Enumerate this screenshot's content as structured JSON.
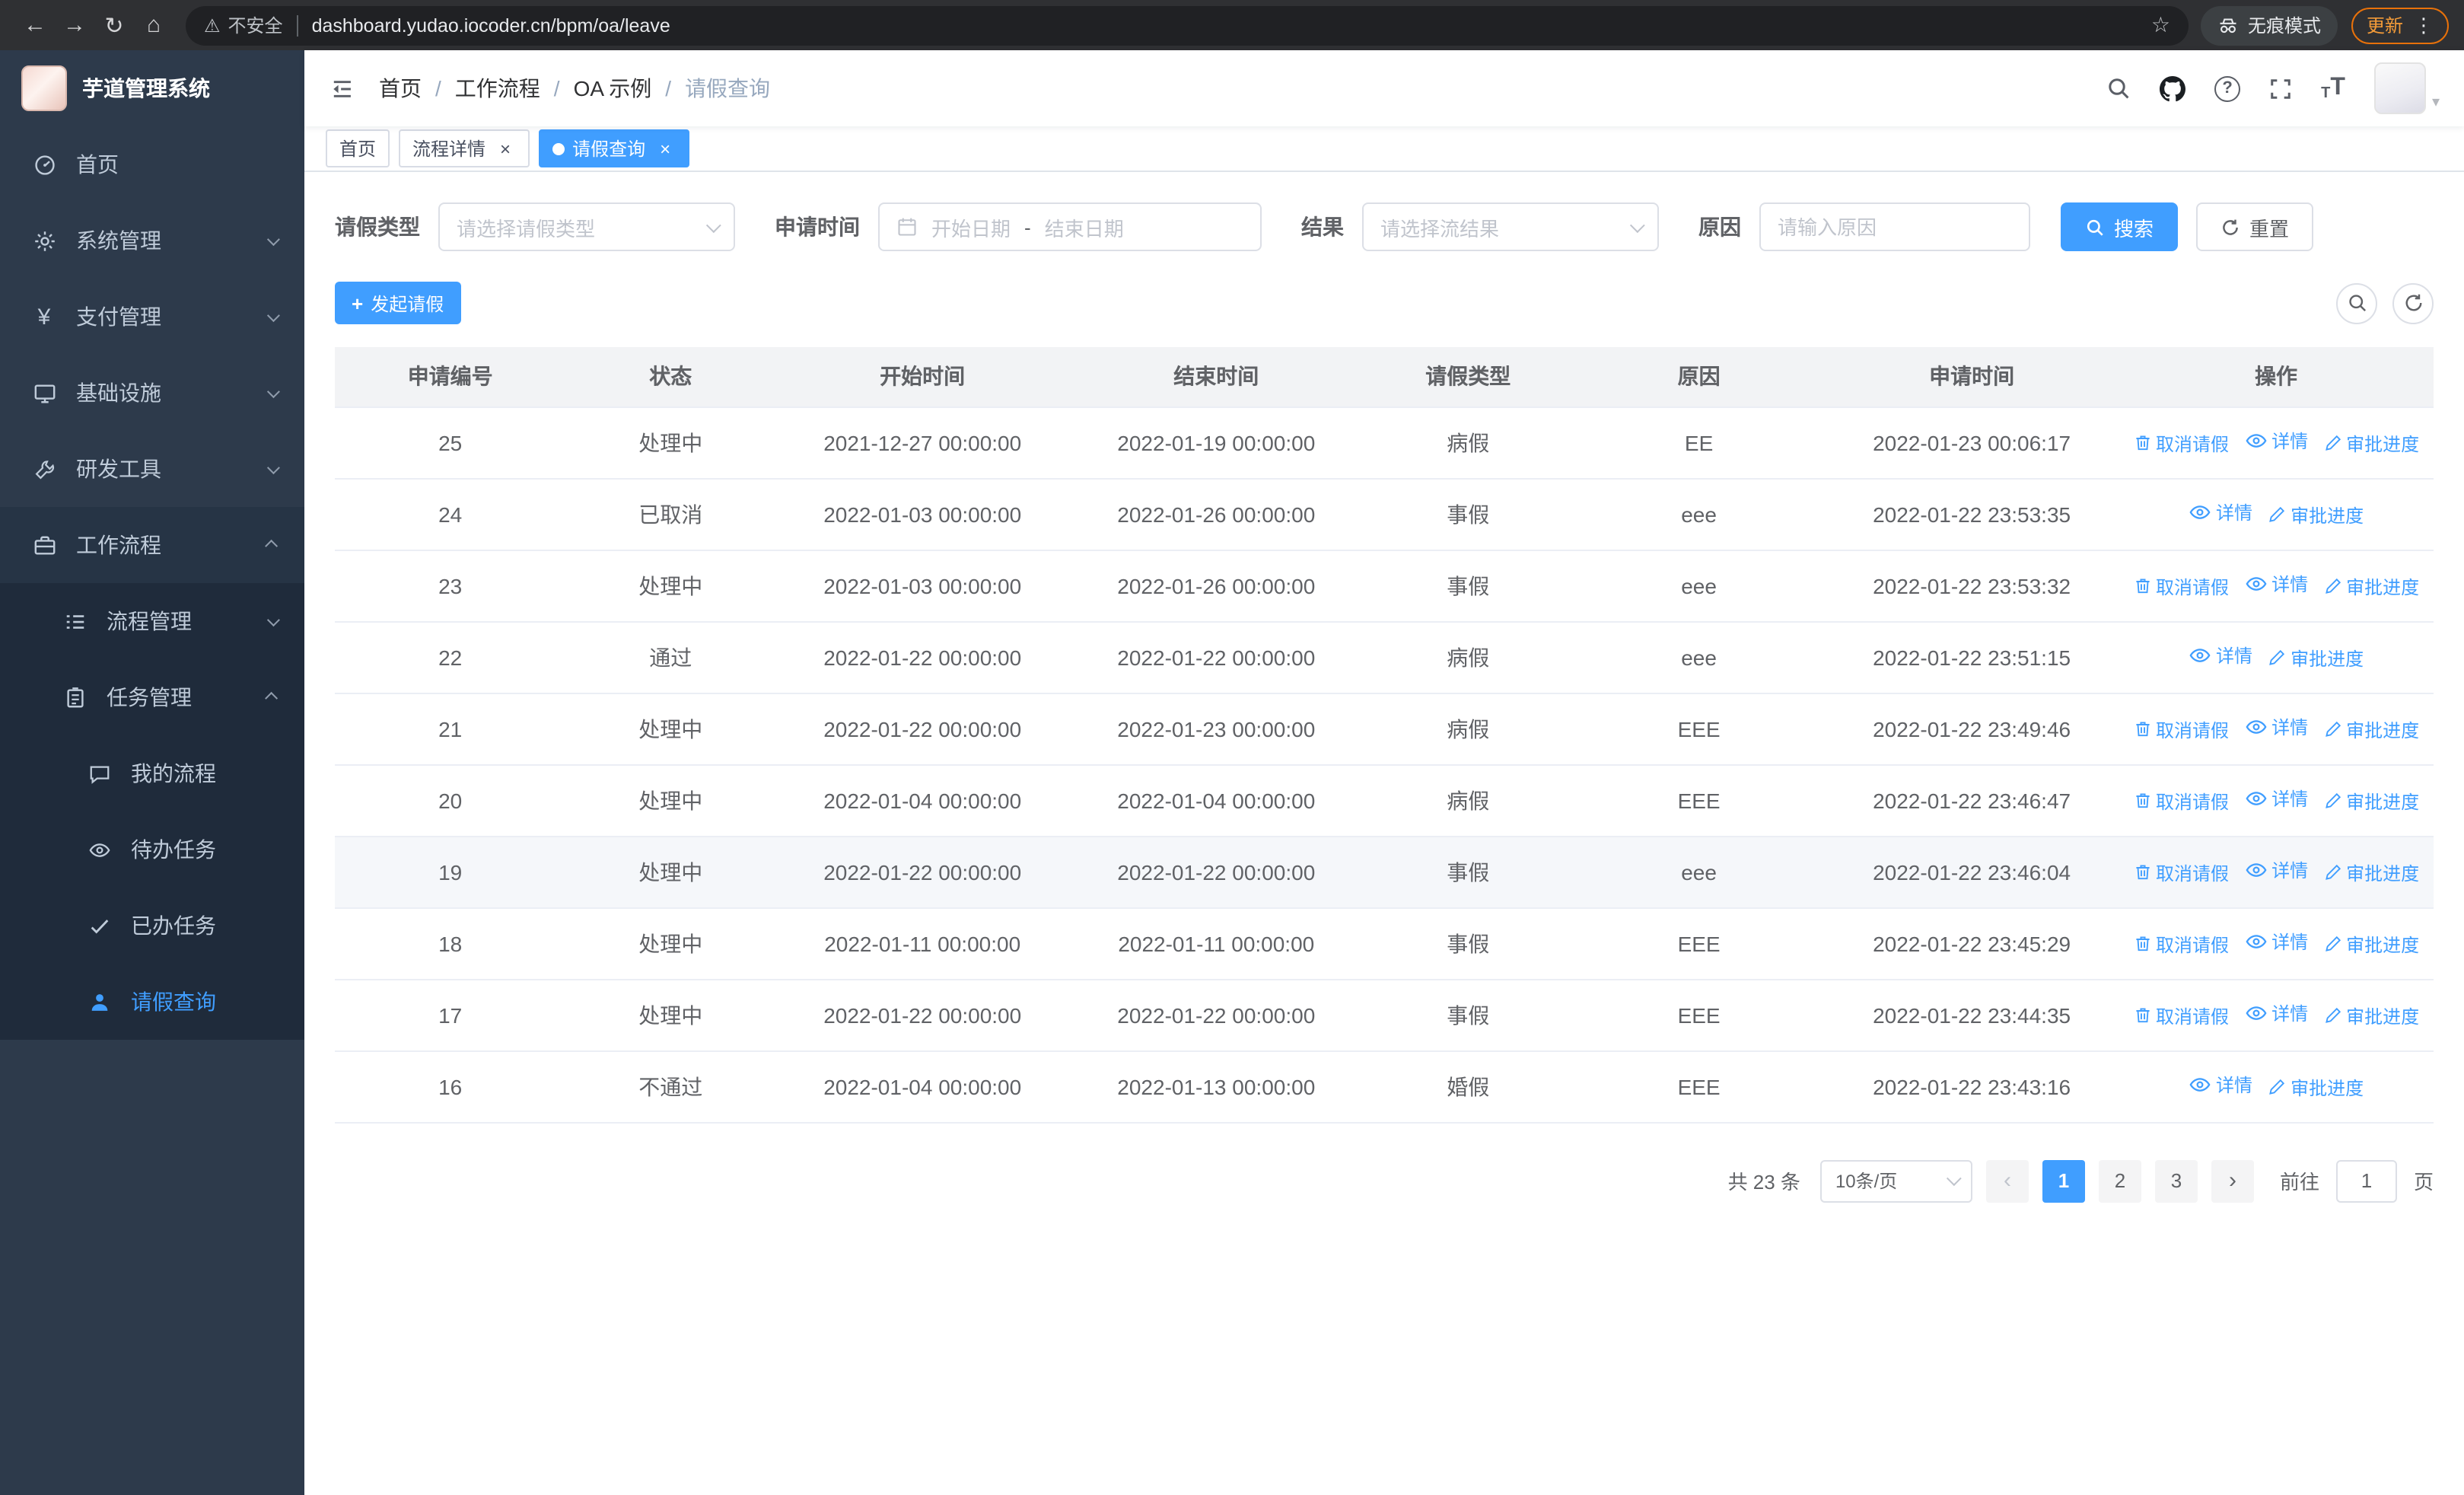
{
  "browser": {
    "security_warning": "不安全",
    "url": "dashboard.yudao.iocoder.cn/bpm/oa/leave",
    "incognito_label": "无痕模式",
    "update_label": "更新"
  },
  "sidebar": {
    "app_title": "芋道管理系统",
    "items": [
      {
        "key": "home",
        "label": "首页",
        "icon": "dashboard-icon",
        "level": 1
      },
      {
        "key": "system",
        "label": "系统管理",
        "icon": "gear-icon",
        "level": 1,
        "chevron": "down"
      },
      {
        "key": "payment",
        "label": "支付管理",
        "icon": "yen-icon",
        "level": 1,
        "chevron": "down"
      },
      {
        "key": "infrastructure",
        "label": "基础设施",
        "icon": "monitor-icon",
        "level": 1,
        "chevron": "down"
      },
      {
        "key": "devtools",
        "label": "研发工具",
        "icon": "wrench-icon",
        "level": 1,
        "chevron": "down"
      },
      {
        "key": "workflow",
        "label": "工作流程",
        "icon": "briefcase-icon",
        "level": 1,
        "chevron": "up",
        "open": true
      },
      {
        "key": "process-mgmt",
        "label": "流程管理",
        "icon": "list-icon",
        "level": 2,
        "chevron": "down",
        "submenu": true
      },
      {
        "key": "task-mgmt",
        "label": "任务管理",
        "icon": "clipboard-icon",
        "level": 2,
        "chevron": "up",
        "open": true,
        "submenu": true
      },
      {
        "key": "my-process",
        "label": "我的流程",
        "icon": "chat-icon",
        "level": 3,
        "submenu": true
      },
      {
        "key": "todo-task",
        "label": "待办任务",
        "icon": "eye-icon",
        "level": 3,
        "submenu": true
      },
      {
        "key": "done-task",
        "label": "已办任务",
        "icon": "check-icon",
        "level": 3,
        "submenu": true
      },
      {
        "key": "leave-query",
        "label": "请假查询",
        "icon": "user-icon",
        "level": 3,
        "submenu": true,
        "active": true
      }
    ]
  },
  "header": {
    "breadcrumbs": [
      "首页",
      "工作流程",
      "OA 示例",
      "请假查询"
    ]
  },
  "tabs": [
    {
      "key": "home",
      "label": "首页",
      "closable": false,
      "active": false
    },
    {
      "key": "process-detail",
      "label": "流程详情",
      "closable": true,
      "active": false
    },
    {
      "key": "leave-query",
      "label": "请假查询",
      "closable": true,
      "active": true
    }
  ],
  "filters": {
    "leave_type_label": "请假类型",
    "leave_type_placeholder": "请选择请假类型",
    "apply_time_label": "申请时间",
    "start_date_placeholder": "开始日期",
    "range_separator": "-",
    "end_date_placeholder": "结束日期",
    "result_label": "结果",
    "result_placeholder": "请选择流结果",
    "reason_label": "原因",
    "reason_placeholder": "请输入原因",
    "search_label": "搜索",
    "reset_label": "重置"
  },
  "toolbar": {
    "create_label": "发起请假"
  },
  "table": {
    "columns": [
      "申请编号",
      "状态",
      "开始时间",
      "结束时间",
      "请假类型",
      "原因",
      "申请时间",
      "操作"
    ],
    "action_labels": {
      "cancel": "取消请假",
      "detail": "详情",
      "progress": "审批进度"
    },
    "rows": [
      {
        "id": "25",
        "status": "处理中",
        "start": "2021-12-27 00:00:00",
        "end": "2022-01-19 00:00:00",
        "type": "病假",
        "reason": "EE",
        "apply_time": "2022-01-23 00:06:17",
        "actions": [
          "cancel",
          "detail",
          "progress"
        ],
        "highlight": false
      },
      {
        "id": "24",
        "status": "已取消",
        "start": "2022-01-03 00:00:00",
        "end": "2022-01-26 00:00:00",
        "type": "事假",
        "reason": "eee",
        "apply_time": "2022-01-22 23:53:35",
        "actions": [
          "detail",
          "progress"
        ],
        "highlight": false
      },
      {
        "id": "23",
        "status": "处理中",
        "start": "2022-01-03 00:00:00",
        "end": "2022-01-26 00:00:00",
        "type": "事假",
        "reason": "eee",
        "apply_time": "2022-01-22 23:53:32",
        "actions": [
          "cancel",
          "detail",
          "progress"
        ],
        "highlight": false
      },
      {
        "id": "22",
        "status": "通过",
        "start": "2022-01-22 00:00:00",
        "end": "2022-01-22 00:00:00",
        "type": "病假",
        "reason": "eee",
        "apply_time": "2022-01-22 23:51:15",
        "actions": [
          "detail",
          "progress"
        ],
        "highlight": false
      },
      {
        "id": "21",
        "status": "处理中",
        "start": "2022-01-22 00:00:00",
        "end": "2022-01-23 00:00:00",
        "type": "病假",
        "reason": "EEE",
        "apply_time": "2022-01-22 23:49:46",
        "actions": [
          "cancel",
          "detail",
          "progress"
        ],
        "highlight": false
      },
      {
        "id": "20",
        "status": "处理中",
        "start": "2022-01-04 00:00:00",
        "end": "2022-01-04 00:00:00",
        "type": "病假",
        "reason": "EEE",
        "apply_time": "2022-01-22 23:46:47",
        "actions": [
          "cancel",
          "detail",
          "progress"
        ],
        "highlight": false
      },
      {
        "id": "19",
        "status": "处理中",
        "start": "2022-01-22 00:00:00",
        "end": "2022-01-22 00:00:00",
        "type": "事假",
        "reason": "eee",
        "apply_time": "2022-01-22 23:46:04",
        "actions": [
          "cancel",
          "detail",
          "progress"
        ],
        "highlight": true
      },
      {
        "id": "18",
        "status": "处理中",
        "start": "2022-01-11 00:00:00",
        "end": "2022-01-11 00:00:00",
        "type": "事假",
        "reason": "EEE",
        "apply_time": "2022-01-22 23:45:29",
        "actions": [
          "cancel",
          "detail",
          "progress"
        ],
        "highlight": false
      },
      {
        "id": "17",
        "status": "处理中",
        "start": "2022-01-22 00:00:00",
        "end": "2022-01-22 00:00:00",
        "type": "事假",
        "reason": "EEE",
        "apply_time": "2022-01-22 23:44:35",
        "actions": [
          "cancel",
          "detail",
          "progress"
        ],
        "highlight": false
      },
      {
        "id": "16",
        "status": "不通过",
        "start": "2022-01-04 00:00:00",
        "end": "2022-01-13 00:00:00",
        "type": "婚假",
        "reason": "EEE",
        "apply_time": "2022-01-22 23:43:16",
        "actions": [
          "detail",
          "progress"
        ],
        "highlight": false
      }
    ]
  },
  "pagination": {
    "total_text": "共 23 条",
    "page_size": "10条/页",
    "pages": [
      "1",
      "2",
      "3"
    ],
    "active_page": "1",
    "goto_label": "前往",
    "goto_value": "1",
    "page_unit": "页"
  },
  "colors": {
    "accent": "#409eff",
    "sidebar": "#2d3a4b",
    "submenu": "#1f2b3b",
    "update_orange": "#e8710a"
  }
}
